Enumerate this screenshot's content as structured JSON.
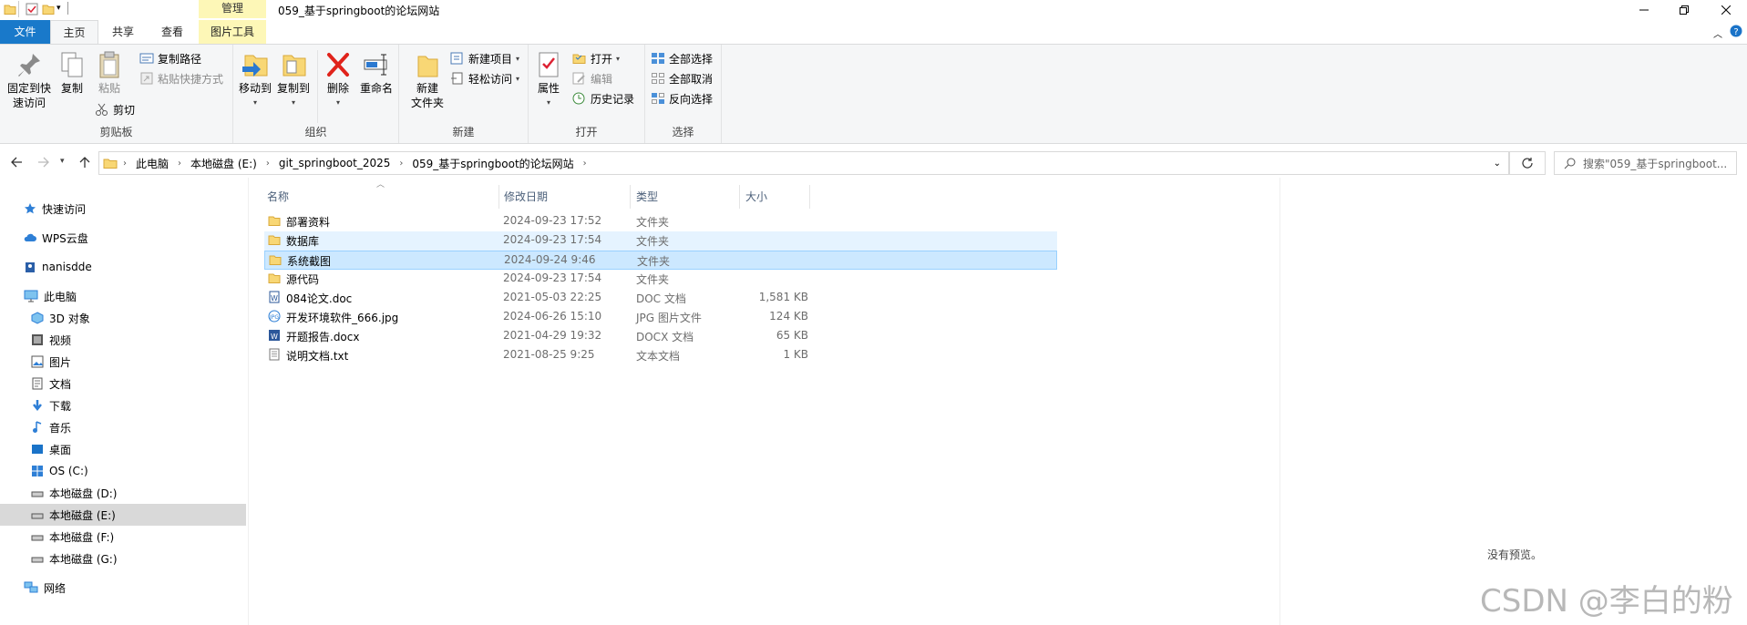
{
  "window": {
    "title": "059_基于springboot的论坛网站",
    "context_tab": "管理"
  },
  "ribbon_tabs": {
    "file": "文件",
    "home": "主页",
    "share": "共享",
    "view": "查看",
    "picture_tools": "图片工具"
  },
  "clipboard": {
    "pin_line1": "固定到快",
    "pin_line2": "速访问",
    "copy": "复制",
    "paste": "粘贴",
    "copy_path": "复制路径",
    "paste_shortcut": "粘贴快捷方式",
    "cut": "剪切",
    "label": "剪贴板"
  },
  "organize": {
    "move_to": "移动到",
    "copy_to": "复制到",
    "delete": "删除",
    "rename": "重命名",
    "label": "组织"
  },
  "new_group": {
    "new_folder_line1": "新建",
    "new_folder_line2": "文件夹",
    "new_item": "新建项目",
    "easy_access": "轻松访问",
    "label": "新建"
  },
  "open_group": {
    "properties": "属性",
    "open": "打开",
    "edit": "编辑",
    "history": "历史记录",
    "label": "打开"
  },
  "select_group": {
    "select_all": "全部选择",
    "select_none": "全部取消",
    "invert": "反向选择",
    "label": "选择"
  },
  "address": {
    "crumbs": [
      "此电脑",
      "本地磁盘 (E:)",
      "git_springboot_2025",
      "059_基于springboot的论坛网站"
    ],
    "search_placeholder": "搜索\"059_基于springboot..."
  },
  "nav": {
    "quick_access": "快速访问",
    "wps": "WPS云盘",
    "user": "nanisdde",
    "this_pc": "此电脑",
    "objects3d": "3D 对象",
    "videos": "视频",
    "pictures": "图片",
    "documents": "文档",
    "downloads": "下载",
    "music": "音乐",
    "desktop": "桌面",
    "drive_c": "OS (C:)",
    "drive_d": "本地磁盘 (D:)",
    "drive_e": "本地磁盘 (E:)",
    "drive_f": "本地磁盘 (F:)",
    "drive_g": "本地磁盘 (G:)",
    "network": "网络"
  },
  "columns": {
    "name": "名称",
    "date": "修改日期",
    "type": "类型",
    "size": "大小"
  },
  "files": [
    {
      "name": "部署资料",
      "date": "2024-09-23 17:52",
      "type": "文件夹",
      "size": "",
      "icon": "folder-icon"
    },
    {
      "name": "数据库",
      "date": "2024-09-23 17:54",
      "type": "文件夹",
      "size": "",
      "icon": "folder-icon"
    },
    {
      "name": "系统截图",
      "date": "2024-09-24 9:46",
      "type": "文件夹",
      "size": "",
      "icon": "folder-icon"
    },
    {
      "name": "源代码",
      "date": "2024-09-23 17:54",
      "type": "文件夹",
      "size": "",
      "icon": "folder-icon"
    },
    {
      "name": "084论文.doc",
      "date": "2021-05-03 22:25",
      "type": "DOC 文档",
      "size": "1,581 KB",
      "icon": "word-doc-icon"
    },
    {
      "name": "开发环境软件_666.jpg",
      "date": "2024-06-26 15:10",
      "type": "JPG 图片文件",
      "size": "124 KB",
      "icon": "image-file-icon"
    },
    {
      "name": "开题报告.docx",
      "date": "2021-04-29 19:32",
      "type": "DOCX 文档",
      "size": "65 KB",
      "icon": "word-docx-icon"
    },
    {
      "name": "说明文档.txt",
      "date": "2021-08-25 9:25",
      "type": "文本文档",
      "size": "1 KB",
      "icon": "text-file-icon"
    }
  ],
  "preview_text": "没有预览。",
  "watermark": "CSDN @李白的粉",
  "colors": {
    "file_tab": "#1979ca",
    "context_tab": "#fdf7b7",
    "row_selected": "#cce8ff",
    "row_hover": "#e5f3ff",
    "folder": "#f8d775"
  }
}
